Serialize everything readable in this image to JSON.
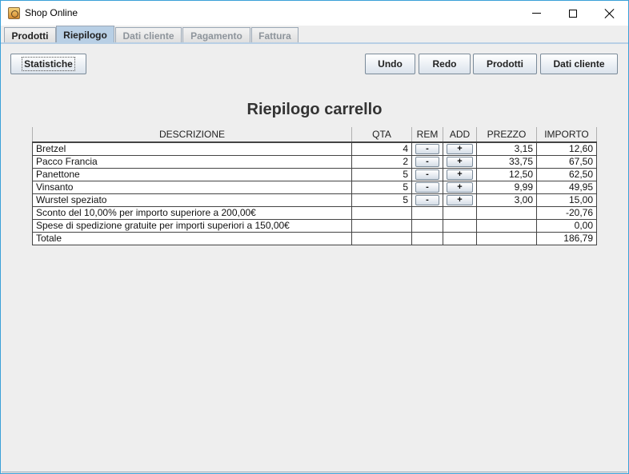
{
  "window": {
    "title": "Shop Online"
  },
  "tabs": [
    {
      "label": "Prodotti",
      "state": "normal"
    },
    {
      "label": "Riepilogo",
      "state": "active"
    },
    {
      "label": "Dati cliente",
      "state": "disabled"
    },
    {
      "label": "Pagamento",
      "state": "disabled"
    },
    {
      "label": "Fattura",
      "state": "disabled"
    }
  ],
  "toolbar": {
    "statistiche": "Statistiche",
    "undo": "Undo",
    "redo": "Redo",
    "prodotti": "Prodotti",
    "dati_cliente": "Dati cliente"
  },
  "cart": {
    "title": "Riepilogo carrello",
    "columns": [
      "DESCRIZIONE",
      "QTA",
      "REM",
      "ADD",
      "PREZZO",
      "IMPORTO"
    ],
    "rem_label": "-",
    "add_label": "+",
    "items": [
      {
        "descrizione": "Bretzel",
        "qta": "4",
        "prezzo": "3,15",
        "importo": "12,60"
      },
      {
        "descrizione": "Pacco Francia",
        "qta": "2",
        "prezzo": "33,75",
        "importo": "67,50"
      },
      {
        "descrizione": "Panettone",
        "qta": "5",
        "prezzo": "12,50",
        "importo": "62,50"
      },
      {
        "descrizione": "Vinsanto",
        "qta": "5",
        "prezzo": "9,99",
        "importo": "49,95"
      },
      {
        "descrizione": "Wurstel speziato",
        "qta": "5",
        "prezzo": "3,00",
        "importo": "15,00"
      }
    ],
    "summary": [
      {
        "descrizione": "Sconto del 10,00% per importo superiore a 200,00€",
        "importo": "-20,76"
      },
      {
        "descrizione": "Spese di spedizione gratuite per importi superiori a 150,00€",
        "importo": "0,00"
      },
      {
        "descrizione": "Totale",
        "importo": "186,79"
      }
    ]
  }
}
